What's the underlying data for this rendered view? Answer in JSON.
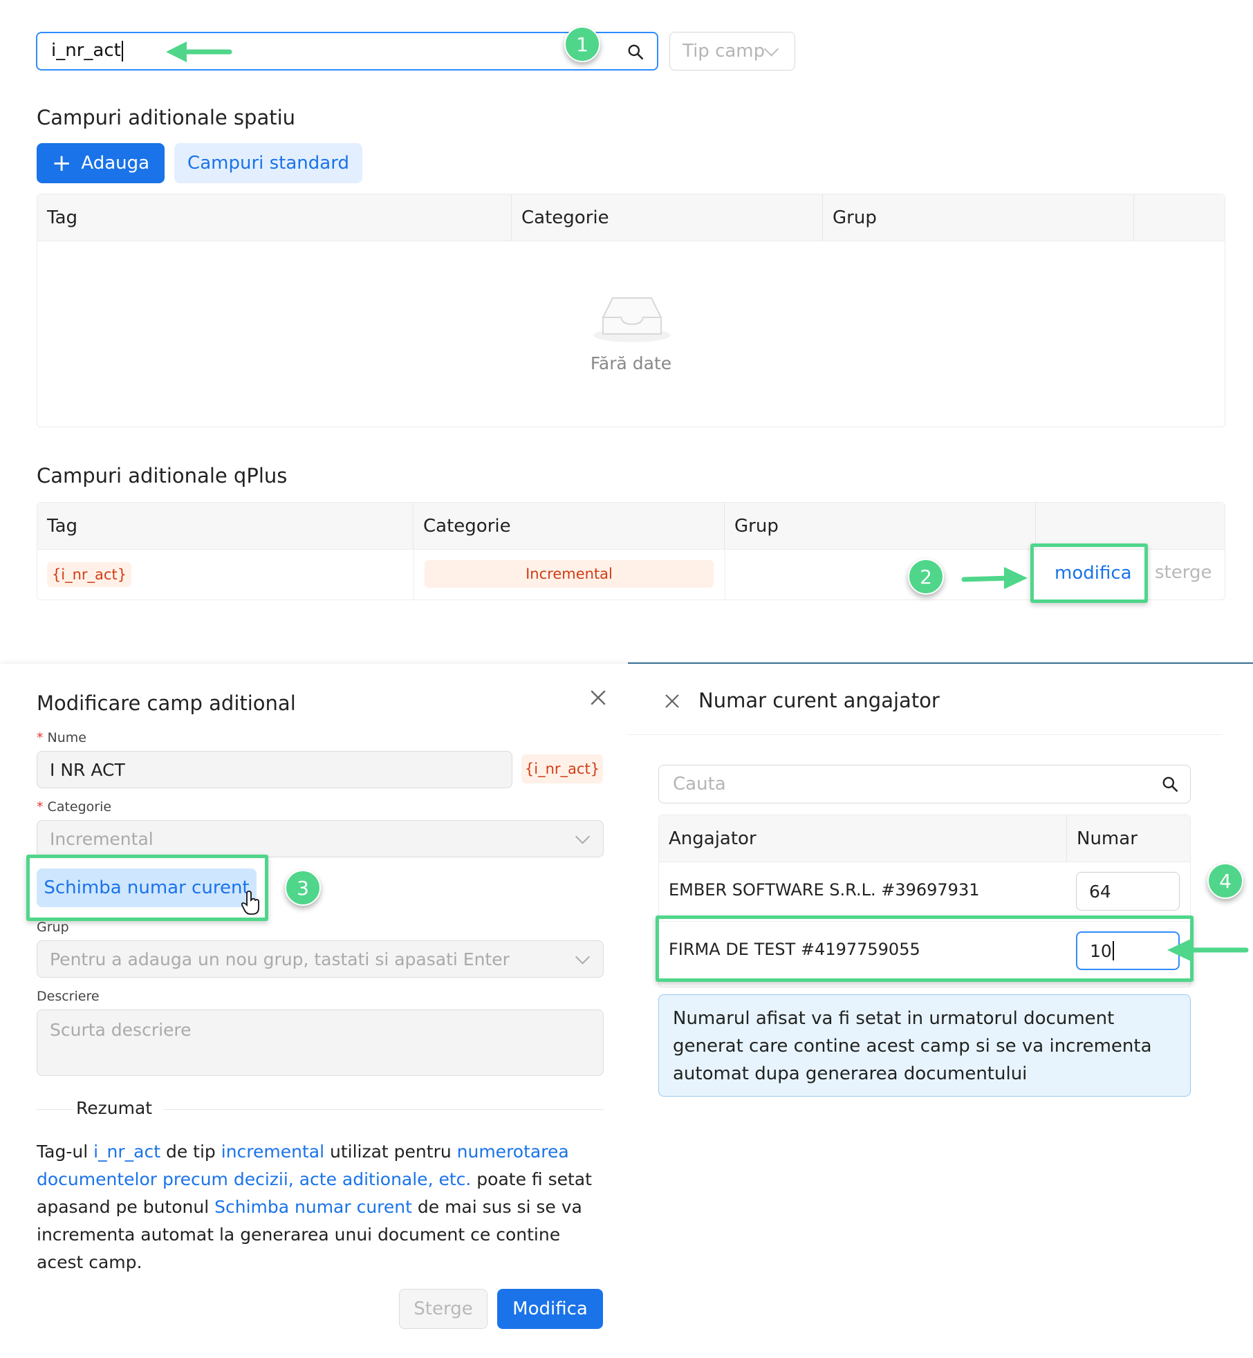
{
  "search": {
    "value": "i_nr_act",
    "type_filter": "Tip camp"
  },
  "section_spatiu": {
    "title": "Campuri aditionale spatiu",
    "add_label": "Adauga",
    "standard_label": "Campuri standard",
    "columns": [
      "Tag",
      "Categorie",
      "Grup"
    ],
    "empty_text": "Fără date"
  },
  "section_qplus": {
    "title": "Campuri aditionale qPlus",
    "columns": [
      "Tag",
      "Categorie",
      "Grup"
    ],
    "row": {
      "tag": "{i_nr_act}",
      "category": "Incremental",
      "edit": "modifica",
      "delete": "sterge"
    }
  },
  "badges": [
    "1",
    "2",
    "3",
    "4"
  ],
  "modal_left": {
    "title": "Modificare camp aditional",
    "name_label": "Nume",
    "name_value": "I NR ACT",
    "name_tag": "{i_nr_act}",
    "category_label": "Categorie",
    "category_value": "Incremental",
    "change_button": "Schimba numar curent",
    "group_label": "Grup",
    "group_placeholder": "Pentru a adauga un nou grup, tastati si apasati Enter",
    "desc_label": "Descriere",
    "desc_placeholder": "Scurta descriere",
    "summary_title": "Rezumat",
    "summary": {
      "p1": "Tag-ul ",
      "tag": "i_nr_act",
      "p2": " de tip ",
      "type": "incremental",
      "p3": " utilizat pentru ",
      "purpose": "numerotarea documentelor precum decizii, acte aditionale, etc.",
      "p4": " poate fi setat apasand pe butonul ",
      "button_ref": "Schimba numar curent",
      "p5": " de mai sus si se va incrementa automat la generarea unui document ce contine acest camp."
    },
    "delete_button": "Sterge",
    "modify_button": "Modifica"
  },
  "modal_right": {
    "title": "Numar curent angajator",
    "search_placeholder": "Cauta",
    "col_employer": "Angajator",
    "col_number": "Numar",
    "rows": [
      {
        "employer": "EMBER SOFTWARE S.R.L. #39697931",
        "number": "64"
      },
      {
        "employer": "FIRMA DE TEST #4197759055",
        "number": "10"
      }
    ],
    "info": "Numarul afisat va fi setat in urmatorul document generat care contine acest camp si se va incrementa automat dupa generarea documentului"
  },
  "colors": {
    "accent": "#1a73e8",
    "annotation": "#4fd68a",
    "tag_text": "#d23c16",
    "tag_bg": "#fff1e8"
  }
}
